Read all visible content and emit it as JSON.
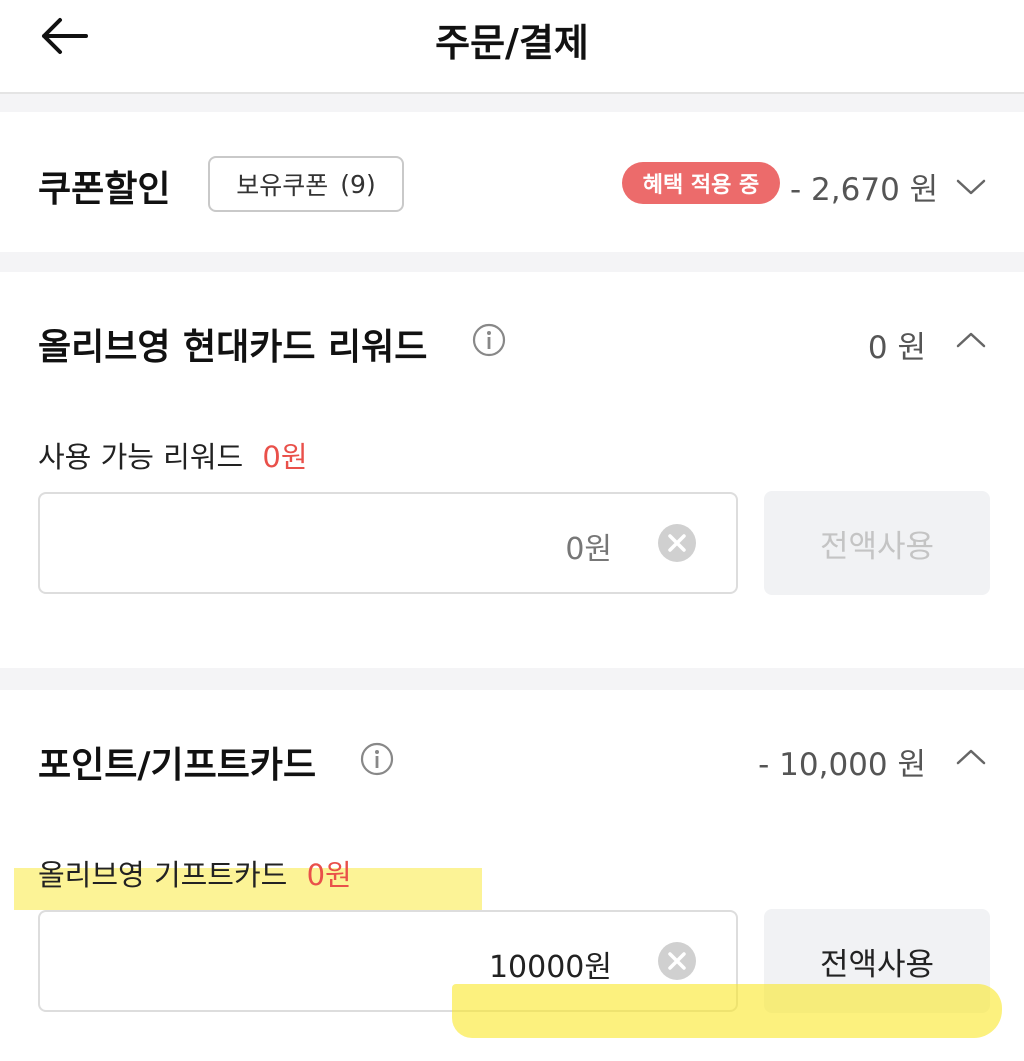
{
  "header": {
    "title": "주문/결제"
  },
  "coupon": {
    "title": "쿠폰할인",
    "owned_label": "보유쿠폰",
    "owned_count": "(9)",
    "badge": "혜택 적용 중",
    "amount": "- 2,670 원"
  },
  "reward": {
    "title": "올리브영 현대카드 리워드",
    "amount": "0 원",
    "available_label": "사용 가능 리워드",
    "available_value": "0원",
    "input_value": "0원",
    "full_use_label": "전액사용"
  },
  "point": {
    "title": "포인트/기프트카드",
    "amount": "- 10,000 원",
    "gift_label": "올리브영 기프트카드",
    "gift_value": "0원",
    "input_value": "10000원",
    "full_use_label": "전액사용"
  },
  "colors": {
    "accent_red": "#e9504a",
    "badge_bg": "#ec6b6b",
    "highlight": "#f9e830"
  }
}
